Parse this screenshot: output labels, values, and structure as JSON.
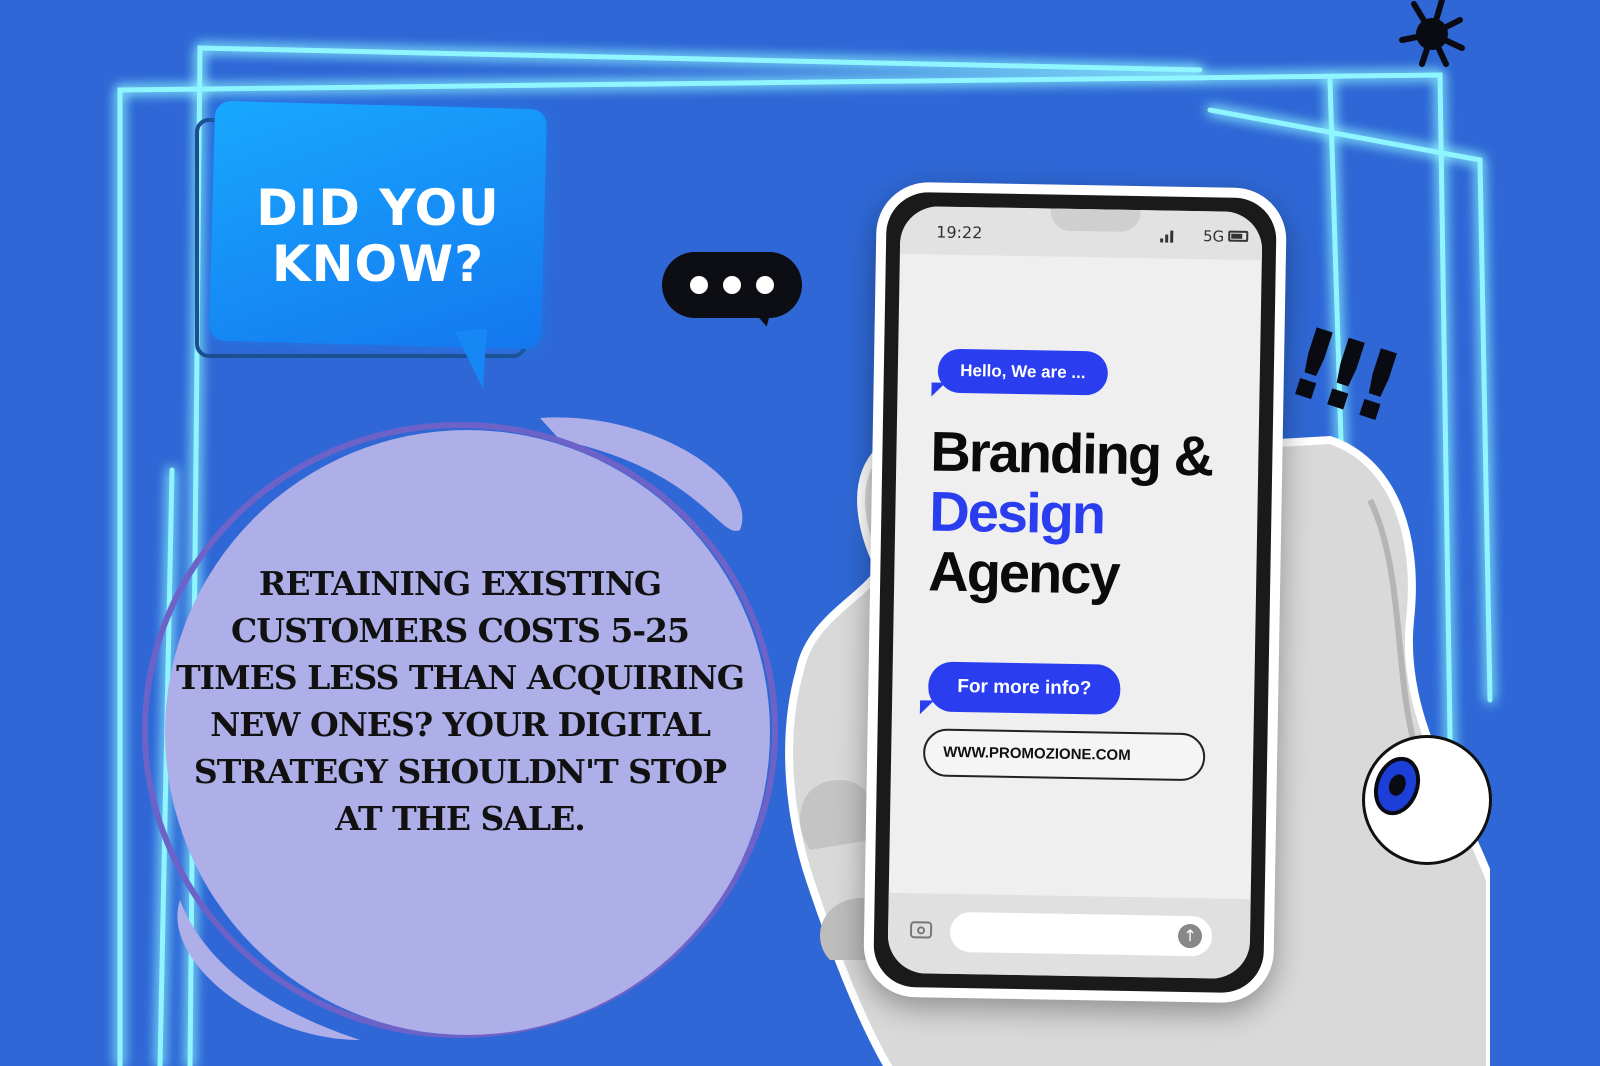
{
  "callout": {
    "line1": "DID YOU",
    "line2": "KNOW?"
  },
  "fact": {
    "lines": [
      "RETAINING EXISTING",
      "CUSTOMERS COSTS 5-25",
      "TIMES LESS THAN ACQUIRING",
      "NEW ONES? YOUR DIGITAL",
      "STRATEGY SHOULDN'T STOP",
      "AT THE SALE."
    ]
  },
  "phone": {
    "time": "19:22",
    "network": "5G",
    "greeting": "Hello, We are ...",
    "headline": {
      "line1": "Branding &",
      "line2": "Design",
      "line3": "Agency"
    },
    "cta": "For more info?",
    "url": "WWW.PROMOZIONE.COM"
  },
  "decor": {
    "exclaim": "!!!",
    "typing_icon": "typing-dots-icon",
    "eye_icon": "eyeball-icon",
    "splat_icon": "ink-splat-icon",
    "camera_icon": "camera-icon",
    "send_icon": "send-arrow-icon"
  },
  "colors": {
    "background": "#2f68d6",
    "neon": "#6ff3ff",
    "callout": "#1687f4",
    "fact_circle": "#aeaee8",
    "accent_blue": "#2a3ef0"
  }
}
